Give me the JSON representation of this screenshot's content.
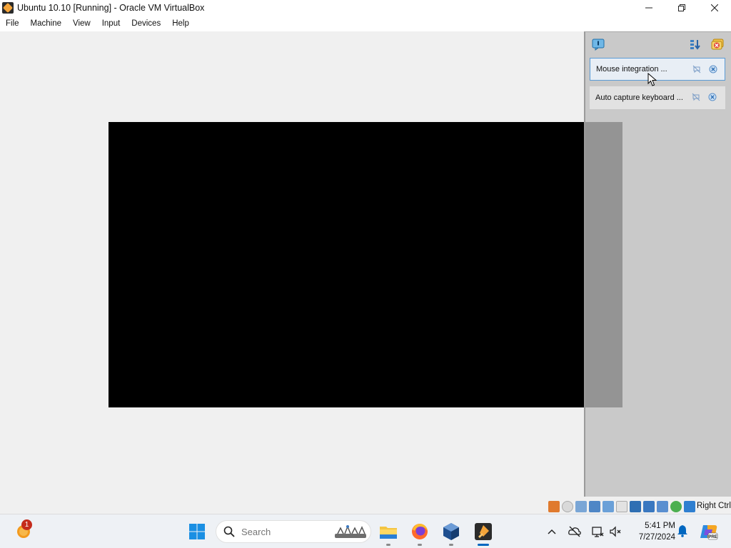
{
  "window": {
    "title": "Ubuntu 10.10 [Running] - Oracle VM VirtualBox"
  },
  "menu": {
    "items": [
      "File",
      "Machine",
      "View",
      "Input",
      "Devices",
      "Help"
    ]
  },
  "notifications": {
    "items": [
      {
        "text": "Mouse integration ..."
      },
      {
        "text": "Auto capture keyboard ..."
      }
    ]
  },
  "statusbar": {
    "host_key": "Right Ctrl"
  },
  "taskbar": {
    "weather_badge": "1",
    "search_placeholder": "Search",
    "clock_time": "5:41 PM",
    "clock_date": "7/27/2024"
  },
  "colors": {
    "accent": "#0067c0",
    "vm_screen": "#000000",
    "badge": "#c42b1c"
  }
}
